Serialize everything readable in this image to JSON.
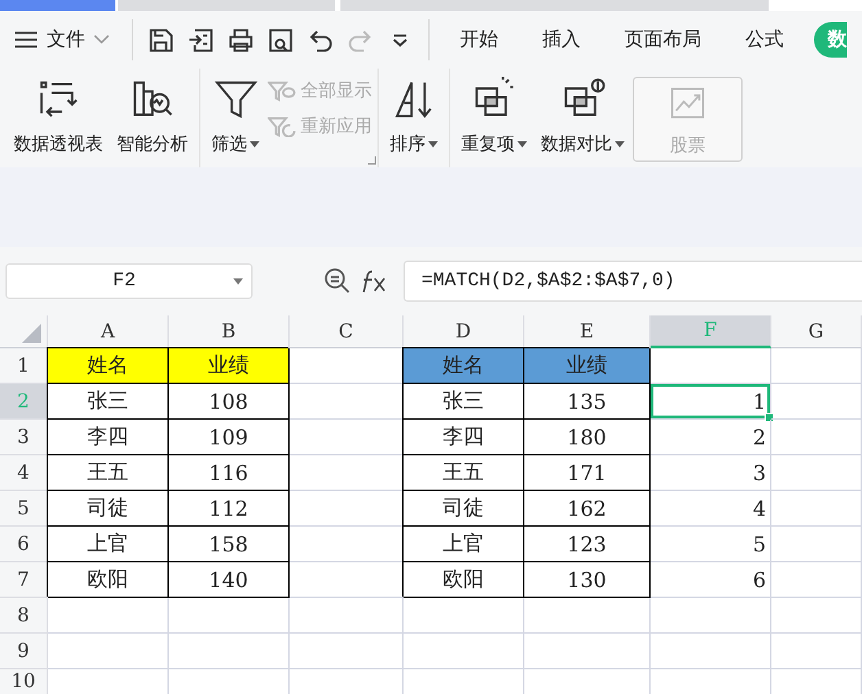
{
  "window_tabs": [
    {
      "selected": true
    },
    {
      "selected": false
    },
    {
      "selected": false
    }
  ],
  "menu": {
    "label": "文件"
  },
  "quick_access": [
    {
      "kind": "save",
      "disabled": false
    },
    {
      "kind": "export",
      "disabled": false
    },
    {
      "kind": "print",
      "disabled": false
    },
    {
      "kind": "preview",
      "disabled": false
    },
    {
      "kind": "undo",
      "disabled": false
    },
    {
      "kind": "redo",
      "disabled": true
    },
    {
      "kind": "more",
      "disabled": false
    }
  ],
  "ribbon_tabs": [
    {
      "label": "开始",
      "selected": false
    },
    {
      "label": "插入",
      "selected": false
    },
    {
      "label": "页面布局",
      "selected": false
    },
    {
      "label": "公式",
      "selected": false
    },
    {
      "label": "数",
      "selected": true
    }
  ],
  "ribbon_groups": [
    [
      {
        "kind": "large",
        "label": "数据透视表",
        "dropdown": false,
        "disabled": false
      },
      {
        "kind": "large",
        "label": "智能分析",
        "dropdown": false,
        "disabled": false
      }
    ],
    [
      {
        "kind": "large",
        "label": "筛选",
        "dropdown": true,
        "disabled": false
      },
      {
        "kind": "small",
        "label": "全部显示",
        "dropdown": false,
        "disabled": true
      },
      {
        "kind": "small",
        "label": "重新应用",
        "dropdown": false,
        "disabled": true
      }
    ],
    [
      {
        "kind": "large",
        "label": "排序",
        "dropdown": true,
        "disabled": false
      }
    ],
    [
      {
        "kind": "large",
        "label": "重复项",
        "dropdown": true,
        "disabled": false
      },
      {
        "kind": "large",
        "label": "数据对比",
        "dropdown": true,
        "disabled": false
      },
      {
        "kind": "boxed",
        "label": "股票",
        "dropdown": false,
        "disabled": true
      }
    ]
  ],
  "name_box": {
    "value": "F2"
  },
  "formula": {
    "value": "=MATCH(D2,$A$2:$A$7,0)"
  },
  "columns": [
    {
      "label": "A",
      "selected": false
    },
    {
      "label": "B",
      "selected": false
    },
    {
      "label": "C",
      "selected": false
    },
    {
      "label": "D",
      "selected": false
    },
    {
      "label": "E",
      "selected": false
    },
    {
      "label": "F",
      "selected": true
    },
    {
      "label": "G",
      "selected": false
    }
  ],
  "rows": [
    {
      "label": "1",
      "selected": false,
      "cells": [
        {
          "text": "姓名",
          "kind": "yellow_header",
          "selected": false
        },
        {
          "text": "业绩",
          "kind": "yellow_header",
          "selected": false
        },
        null,
        {
          "text": "姓名",
          "kind": "blue_header",
          "selected": false
        },
        {
          "text": "业绩",
          "kind": "blue_header",
          "selected": false
        },
        null,
        null
      ]
    },
    {
      "label": "2",
      "selected": true,
      "cells": [
        {
          "text": "张三",
          "kind": "bordered",
          "selected": false
        },
        {
          "text": "108",
          "kind": "bordered",
          "selected": false
        },
        null,
        {
          "text": "张三",
          "kind": "bordered",
          "selected": false
        },
        {
          "text": "135",
          "kind": "bordered",
          "selected": false
        },
        {
          "text": "1",
          "kind": "number",
          "selected": true
        },
        null
      ]
    },
    {
      "label": "3",
      "selected": false,
      "cells": [
        {
          "text": "李四",
          "kind": "bordered",
          "selected": false
        },
        {
          "text": "109",
          "kind": "bordered",
          "selected": false
        },
        null,
        {
          "text": "李四",
          "kind": "bordered",
          "selected": false
        },
        {
          "text": "180",
          "kind": "bordered",
          "selected": false
        },
        {
          "text": "2",
          "kind": "number",
          "selected": false
        },
        null
      ]
    },
    {
      "label": "4",
      "selected": false,
      "cells": [
        {
          "text": "王五",
          "kind": "bordered",
          "selected": false
        },
        {
          "text": "116",
          "kind": "bordered",
          "selected": false
        },
        null,
        {
          "text": "王五",
          "kind": "bordered",
          "selected": false
        },
        {
          "text": "171",
          "kind": "bordered",
          "selected": false
        },
        {
          "text": "3",
          "kind": "number",
          "selected": false
        },
        null
      ]
    },
    {
      "label": "5",
      "selected": false,
      "cells": [
        {
          "text": "司徒",
          "kind": "bordered",
          "selected": false
        },
        {
          "text": "112",
          "kind": "bordered",
          "selected": false
        },
        null,
        {
          "text": "司徒",
          "kind": "bordered",
          "selected": false
        },
        {
          "text": "162",
          "kind": "bordered",
          "selected": false
        },
        {
          "text": "4",
          "kind": "number",
          "selected": false
        },
        null
      ]
    },
    {
      "label": "6",
      "selected": false,
      "cells": [
        {
          "text": "上官",
          "kind": "bordered",
          "selected": false
        },
        {
          "text": "158",
          "kind": "bordered",
          "selected": false
        },
        null,
        {
          "text": "上官",
          "kind": "bordered",
          "selected": false
        },
        {
          "text": "123",
          "kind": "bordered",
          "selected": false
        },
        {
          "text": "5",
          "kind": "number",
          "selected": false
        },
        null
      ]
    },
    {
      "label": "7",
      "selected": false,
      "cells": [
        {
          "text": "欧阳",
          "kind": "bordered",
          "selected": false
        },
        {
          "text": "140",
          "kind": "bordered",
          "selected": false
        },
        null,
        {
          "text": "欧阳",
          "kind": "bordered",
          "selected": false
        },
        {
          "text": "130",
          "kind": "bordered",
          "selected": false
        },
        {
          "text": "6",
          "kind": "number",
          "selected": false
        },
        null
      ]
    },
    {
      "label": "8",
      "selected": false,
      "cells": [
        null,
        null,
        null,
        null,
        null,
        null,
        null
      ]
    },
    {
      "label": "9",
      "selected": false,
      "cells": [
        null,
        null,
        null,
        null,
        null,
        null,
        null
      ]
    },
    {
      "label": "10",
      "selected": false,
      "cells": [
        null,
        null,
        null,
        null,
        null,
        null,
        null
      ]
    }
  ]
}
